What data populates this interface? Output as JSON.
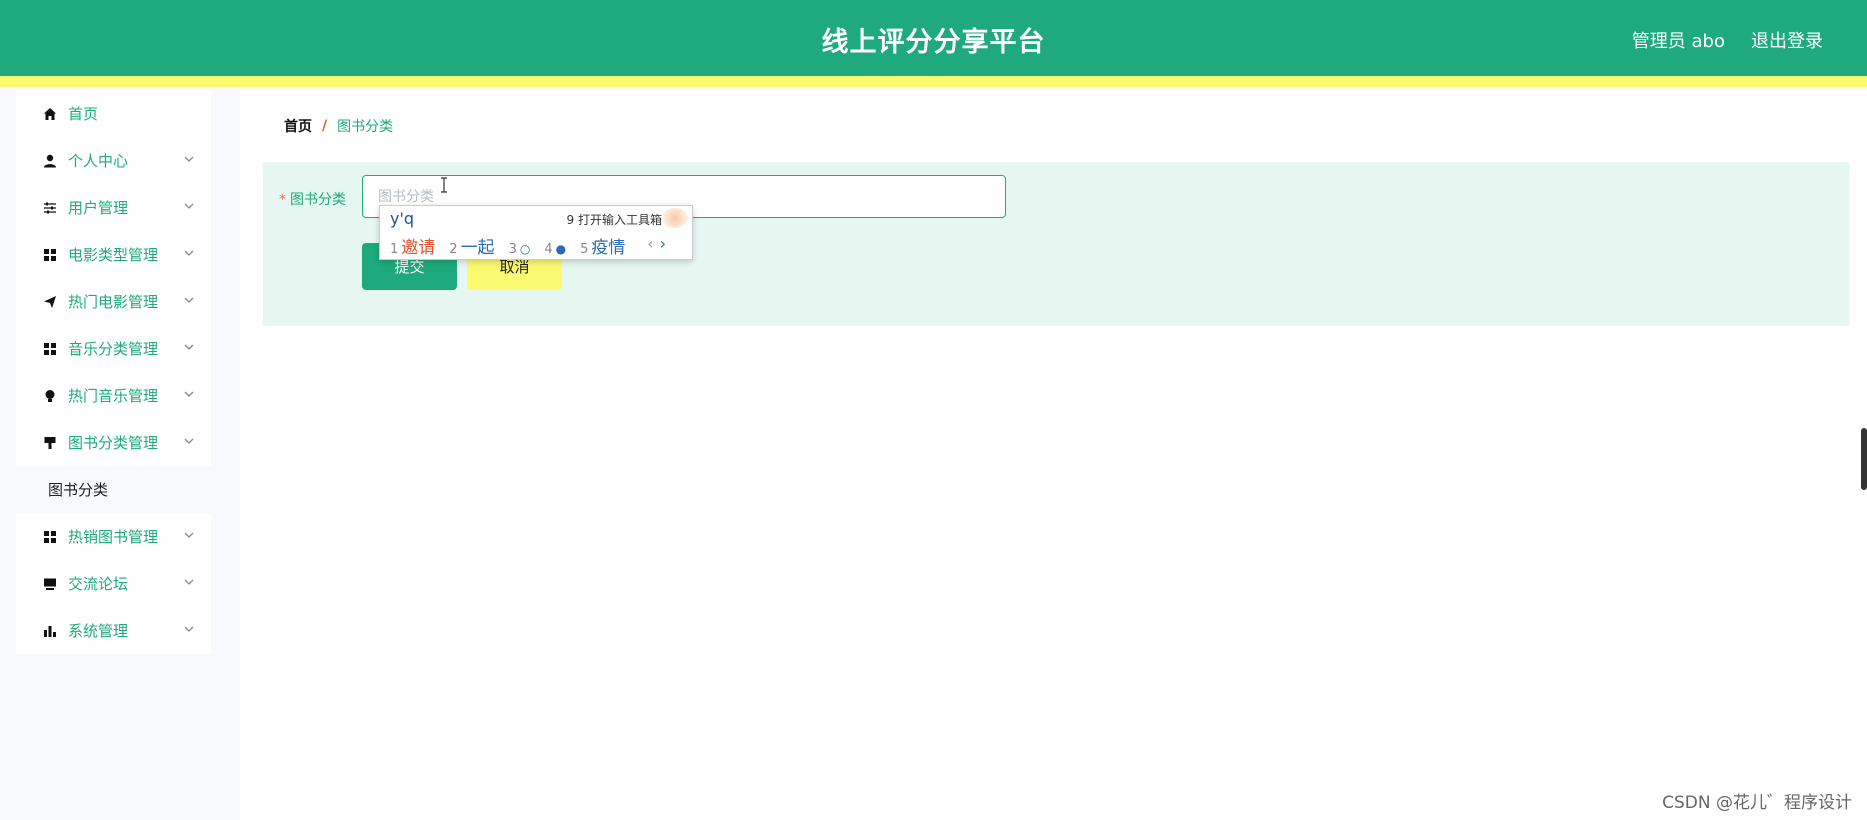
{
  "header": {
    "title": "线上评分分享平台",
    "user": "管理员 abo",
    "logout": "退出登录",
    "colors": {
      "primary": "#1eaa7c",
      "stripe": "#fbf970"
    }
  },
  "sidebar": {
    "items": [
      {
        "label": "首页",
        "icon": "home-icon",
        "chevron": false
      },
      {
        "label": "个人中心",
        "icon": "user-icon",
        "chevron": true
      },
      {
        "label": "用户管理",
        "icon": "sliders-icon",
        "chevron": true
      },
      {
        "label": "电影类型管理",
        "icon": "grid-icon",
        "chevron": true
      },
      {
        "label": "热门电影管理",
        "icon": "send-icon",
        "chevron": true
      },
      {
        "label": "音乐分类管理",
        "icon": "grid-icon",
        "chevron": true
      },
      {
        "label": "热门音乐管理",
        "icon": "bulb-icon",
        "chevron": true
      },
      {
        "label": "图书分类管理",
        "icon": "brush-icon",
        "chevron": true
      },
      {
        "label": "热销图书管理",
        "icon": "grid-icon",
        "chevron": true
      },
      {
        "label": "交流论坛",
        "icon": "monitor-icon",
        "chevron": true
      },
      {
        "label": "系统管理",
        "icon": "chart-icon",
        "chevron": true
      }
    ],
    "submenu": {
      "label": "图书分类"
    }
  },
  "breadcrumb": {
    "home": "首页",
    "separator": "/",
    "current": "图书分类"
  },
  "form": {
    "label": "图书分类",
    "required_mark": "*",
    "placeholder": "图书分类",
    "value": "",
    "submit": "提交",
    "cancel": "取消"
  },
  "ime": {
    "pinyin": "y'q",
    "toolbox": "9 打开输入工具箱",
    "candidates": [
      {
        "n": "1",
        "w": "邀请"
      },
      {
        "n": "2",
        "w": "一起"
      },
      {
        "n": "3",
        "w": "○"
      },
      {
        "n": "4",
        "w": "●"
      },
      {
        "n": "5",
        "w": "疫情"
      }
    ],
    "prev": "‹",
    "next": "›"
  },
  "watermark": "CSDN @花儿゛程序设计"
}
